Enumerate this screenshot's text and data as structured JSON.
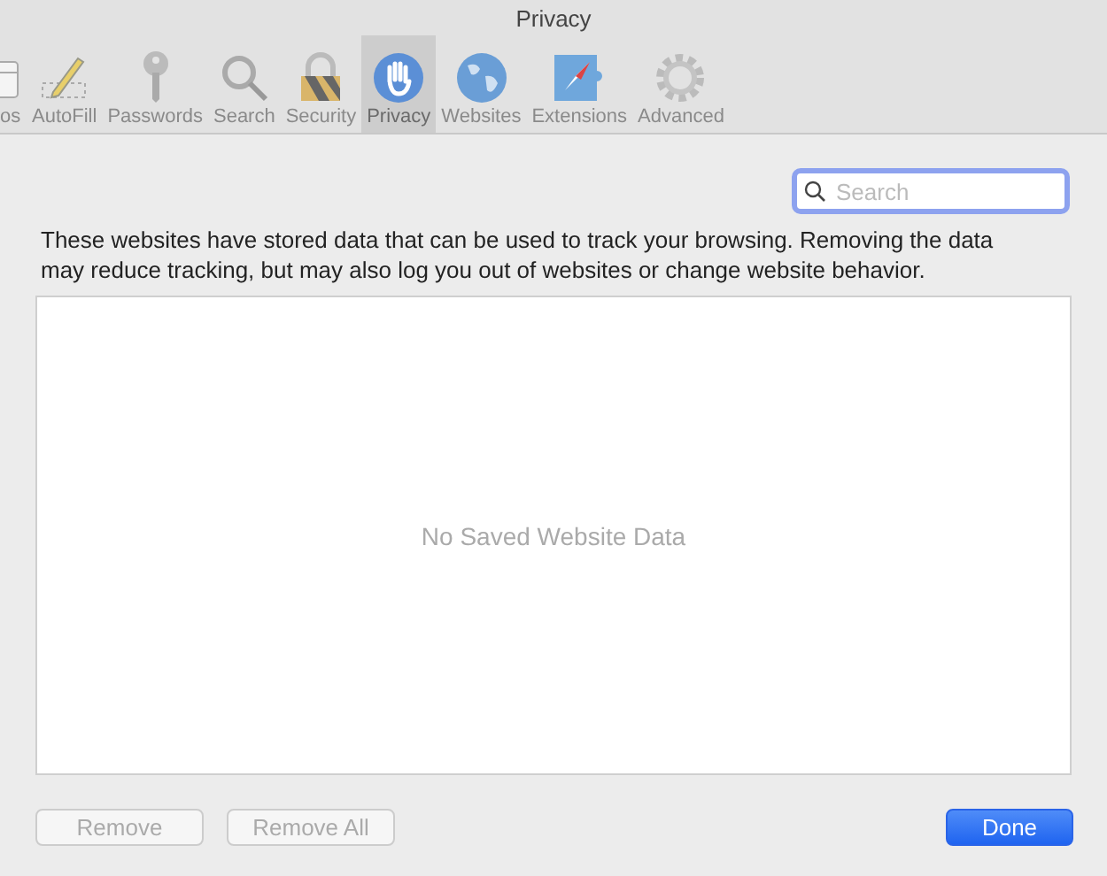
{
  "window": {
    "title": "Privacy"
  },
  "toolbar": [
    {
      "label": "os",
      "kind": "tabs",
      "selected": false
    },
    {
      "label": "AutoFill",
      "kind": "pencil",
      "selected": false
    },
    {
      "label": "Passwords",
      "kind": "key",
      "selected": false
    },
    {
      "label": "Search",
      "kind": "search",
      "selected": false
    },
    {
      "label": "Security",
      "kind": "lock",
      "selected": false
    },
    {
      "label": "Privacy",
      "kind": "hand",
      "selected": true
    },
    {
      "label": "Websites",
      "kind": "globe",
      "selected": false
    },
    {
      "label": "Extensions",
      "kind": "puzzle",
      "selected": false
    },
    {
      "label": "Advanced",
      "kind": "gear",
      "selected": false
    }
  ],
  "search": {
    "placeholder": "Search"
  },
  "description": "These websites have stored data that can be used to track your browsing. Removing the data may reduce tracking, but may also log you out of websites or change website behavior.",
  "list": {
    "empty_message": "No Saved Website Data"
  },
  "buttons": [
    {
      "label": "Remove",
      "disabled": true,
      "kind": "normal"
    },
    {
      "label": "Remove All",
      "disabled": true,
      "kind": "normal"
    },
    {
      "label": "Done",
      "disabled": false,
      "kind": "default"
    }
  ]
}
